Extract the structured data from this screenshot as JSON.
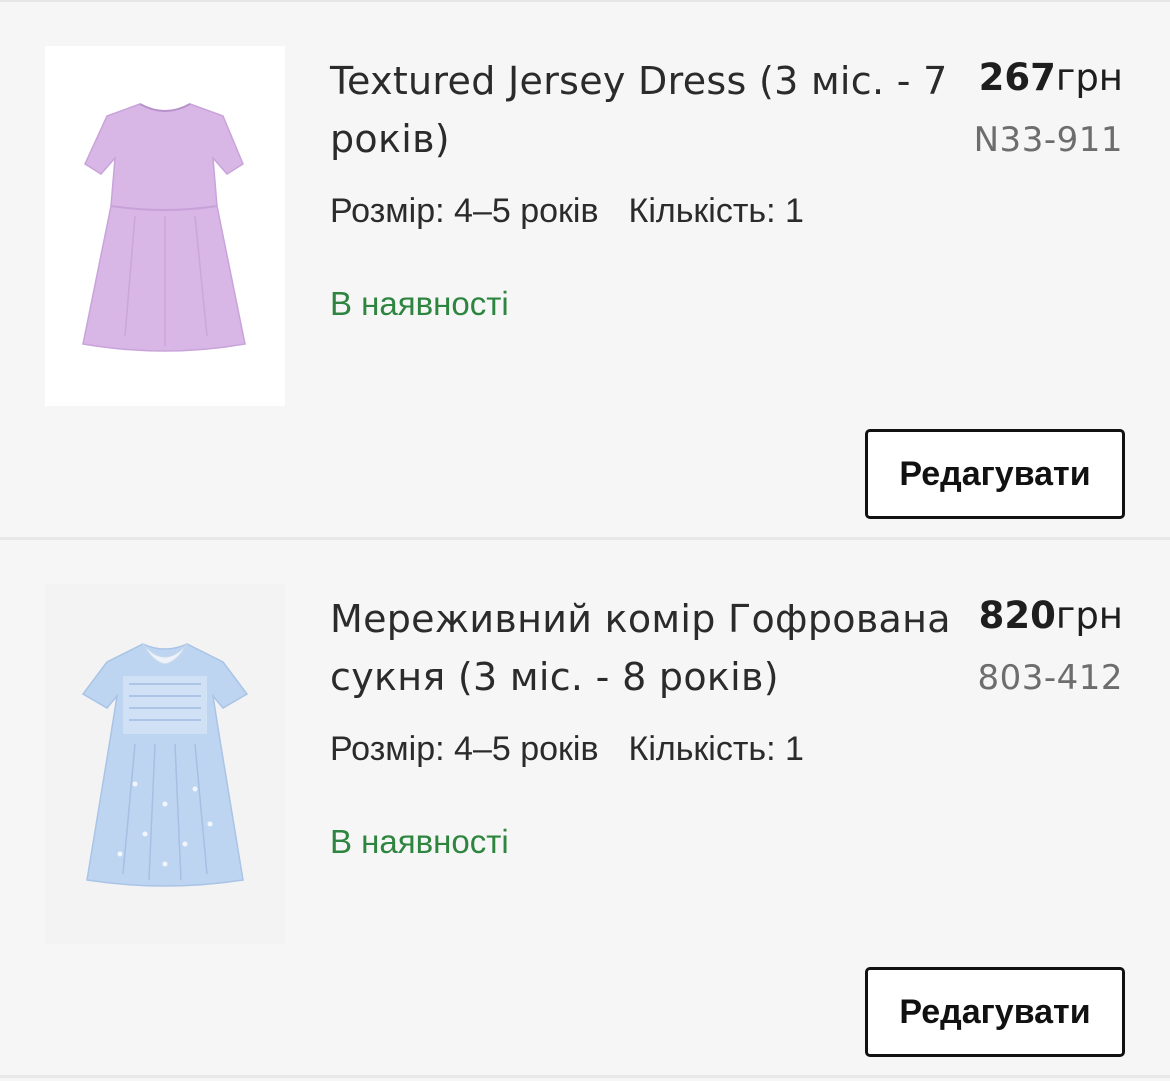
{
  "items": [
    {
      "title": "Textured Jersey Dress (3 міс. - 7 років)",
      "price_amount": "267",
      "price_currency": "грн",
      "product_code": "N33-911",
      "size_label": "Розмір: 4–5 років",
      "quantity_label": "Кількість: 1",
      "stock_status": "В наявності",
      "edit_label": "Редагувати",
      "image_icon": "lilac-dress-image",
      "dress_color": "#d9b8e6"
    },
    {
      "title": "Мереживний комір Гофрована сукня (3 міс. - 8 років)",
      "price_amount": "820",
      "price_currency": "грн",
      "product_code": "803-412",
      "size_label": "Розмір: 4–5 років",
      "quantity_label": "Кількість: 1",
      "stock_status": "В наявності",
      "edit_label": "Редагувати",
      "image_icon": "blue-floral-dress-image",
      "dress_color": "#bcd4f2"
    }
  ],
  "colors": {
    "stock_green": "#2e8540",
    "background": "#f6f6f6",
    "button_border": "#111111"
  }
}
